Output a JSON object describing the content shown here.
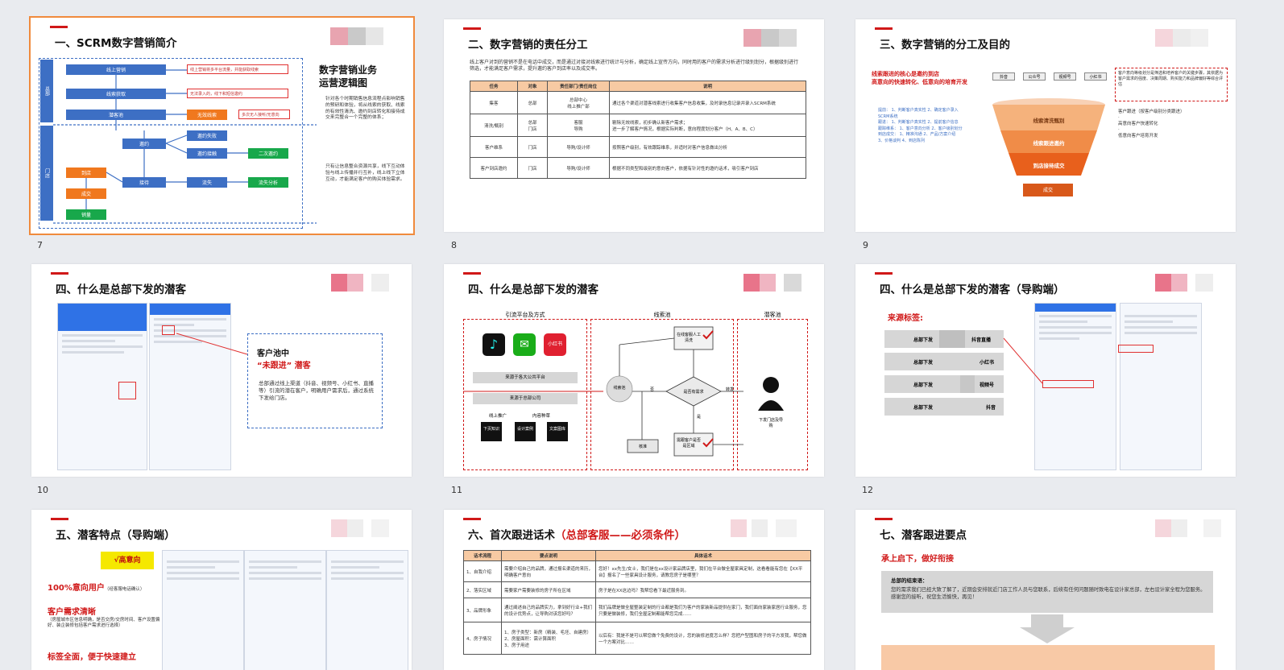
{
  "slides": [
    {
      "num": "7",
      "title": "一、SCRM数字营销简介",
      "active": true,
      "side_labels": [
        "总部",
        "门店"
      ],
      "flow": {
        "b1": "线上营销",
        "b2": "线索获取",
        "b3": "潜客池",
        "b4": "无效线索",
        "b5": "邀约",
        "b6": "邀约失败",
        "b7": "邀约接触",
        "b8": "二次邀约",
        "b9": "到店",
        "b10": "成交",
        "b11": "销量",
        "b12": "接待",
        "b13": "流失",
        "b14": "流失分析"
      },
      "notes": [
        "线上营销将多平台流量，并能获取线索",
        "无法录入的，线下和短信邀约",
        "多次无人接听/无意向"
      ],
      "heading": "数字营销业务运营逻辑图",
      "bullets": [
        "针对各个时期销售信息流程点影响销售的预研和体验，将从线索的获取、线索的有效性清洗、邀约到店转化和接待成交来完整合一个完整的体系；",
        "只有让信息整合资源共享，线下互动体验与线上传播并行互补，线上线下立体互动，才能满足客户的购买体验需求。"
      ]
    },
    {
      "num": "8",
      "title": "二、数字营销的责任分工",
      "intro": "线上客户对到的营销不是在电话中成交，而是通过对接对线索进行统计与分析，确定线上宣传方向，同时用的客户的需求分析进行级别划分，根据级别进行筛选，才能满足客户需求，提升邀约客户到店率以及成交率。",
      "headers": [
        "任务",
        "对象",
        "责任部门/责任岗位",
        "说明"
      ],
      "rows": [
        [
          "集客",
          "总部",
          "总部中心\n线上推广部",
          "通过各个渠道对潜客线索进行收集客户信息收集，及时录信息记录并录入SCRM系统"
        ],
        [
          "清洗/甄别",
          "总部\n门店",
          "客服\n导购",
          "剔除无效线索，初步确认新客户需求；\n进一步了解客户情况，根据实际判断，意向程度划分客户（H、A、B、C）"
        ],
        [
          "客户维系",
          "门店",
          "导购/设计师",
          "按照客户级别，有效跟踪维系，并适时对客户信息做出分析"
        ],
        [
          "客户到店邀约",
          "门店",
          "导购/设计师",
          "根据不同类型和级别的意向客户，依据有针对性的邀约话术，吸引客户到店"
        ]
      ]
    },
    {
      "num": "9",
      "title": "三、数字营销的分工及目的",
      "red_head": "线索跟进的核心是邀约到店\n高意向的快速转化、低意向的培育开发",
      "channels": [
        "抖音",
        "公众号",
        "视频号",
        "小红书"
      ],
      "funnel": [
        "线索清洗甄别",
        "线索跟进邀约",
        "到店接待成交",
        "成交"
      ],
      "left_notes": [
        "提前：",
        "1、判断客户真实性",
        "2、确定客户录入SCRM系统",
        "跟进：",
        "1、判断客户真实性",
        "2、提前客户信息",
        "跟踪维系：",
        "1、客户意向分析",
        "2、客户级别划分",
        "到店成交：",
        "1、精准沟通",
        "2、产品/方案介绍",
        "3、价格谈判",
        "4、到店陈列"
      ],
      "right_box": "客户意向等级划分是筛选和培养客户的关键步骤，其依据为客户需求的强度、决策周期、购买能力和品牌偏好等综合评估",
      "right_text": "客户跟进（按客户级别分类跟进）\n·\n高意向客户快速转化\n·\n低意向客户培育开发"
    },
    {
      "num": "10",
      "title": "四、什么是总部下发的潜客",
      "pool_title": "客户池中",
      "pool_sub": "“未跟进” 潜客",
      "pool_desc": "总部通过线上渠道（抖音、视频号、小红书、直播等）引流的潜在客户，明确用户需求后，通过系统下发给门店。"
    },
    {
      "num": "11",
      "title": "四、什么是总部下发的潜客",
      "col_heads": [
        "引流平台及方式",
        "线索池",
        "潜客池"
      ],
      "apps": [
        "抖音",
        "微信",
        "小红书"
      ],
      "bars": [
        "来源于各大公共平台",
        "来源于总部公司"
      ],
      "bottom_labels": [
        "线上推广",
        "内容种草"
      ],
      "tiles": [
        "下页知识",
        "设计案例",
        "文案图库"
      ],
      "nodes": [
        "线索池",
        "在线客服人工清洗",
        "是否有需求",
        "否",
        "是",
        "转发",
        "核准",
        "需跟客户是否是区域",
        "下发门店及导购"
      ]
    },
    {
      "num": "12",
      "title": "四、什么是总部下发的潜客（导购端）",
      "src_title": "来源标签:",
      "sources": [
        [
          "总部下发",
          "抖音直播"
        ],
        [
          "总部下发",
          "小红书"
        ],
        [
          "总部下发",
          "视频号"
        ],
        [
          "总部下发",
          "抖音"
        ]
      ]
    },
    {
      "num": "",
      "title": "五、潜客特点（导购端）",
      "tag": "√高意向",
      "p1": "100%意向用户",
      "p1_note": "（经客服电话确认）",
      "p2": "客户需求清晰",
      "p2_note": "（房屋城市区信息明确，是否交房/交房时间、客户设置偏好、装企装修包括客户需求进行选择）",
      "p3": "标签全面，便于快速建立"
    },
    {
      "num": "",
      "title": "六、首次跟进话术",
      "title_red": "（总部客服——必须条件）",
      "headers": [
        "话术流程",
        "要点说明",
        "具体话术"
      ],
      "rows": [
        [
          "1、自我介绍",
          "需要介绍自己的品牌，通过报名渠道的来历，明确客户意向",
          "您好！xx先生/女士，我们是在xx设计家品牌店里，我们在平台做全屋家具定制，这看看能有您在【XX平台】报名了一些家具设计服务，请教您房子是哪里？"
        ],
        [
          "2、落实区域",
          "需要家户需要装修的房子所在区域",
          "房子是在XX这边吗？我帮您看下最近服务到。"
        ],
        [
          "3、品牌形象",
          "通过阐述自己的品牌实力，拿到好行业+我们的设计优势点，让导购对该您好吗？",
          "我们品牌是做全屋整装定制的行业都是我们为客户的家装新品提供在家门，我们面向家装家居行业服务，您只要是做装修，我们全屋定制都能帮您完成……"
        ],
        [
          "4、房子情况",
          "1、房子类型：新房（精装、毛坯、自建房）\n2、房屋面积：需计算面积\n3、房子用途",
          "以后有：我是不是可以帮您做个免费的设计，您的装修进度怎么样？您把户型图和房子的平方发我，帮您做一个方案对比……"
        ]
      ]
    },
    {
      "num": "",
      "title": "七、潜客跟进要点",
      "red": "承上启下，做好衔接",
      "box_title": "总部的结束语：",
      "box_text": "您的需求我们已经大致了解了，近期会安排就近门店工作人员与您联系，后续有任何问题随时致电在设计家总部，左右设计家全程为您服务。感谢您的接听，祝您生活愉快，再见！"
    }
  ],
  "colors": {
    "accent_red": "#d01818",
    "active_outline": "#f08a3c",
    "flow_blue": "#3d6fc4",
    "flow_orange": "#f0781e",
    "flow_green": "#18a84b",
    "table_head": "#f7caa3"
  }
}
